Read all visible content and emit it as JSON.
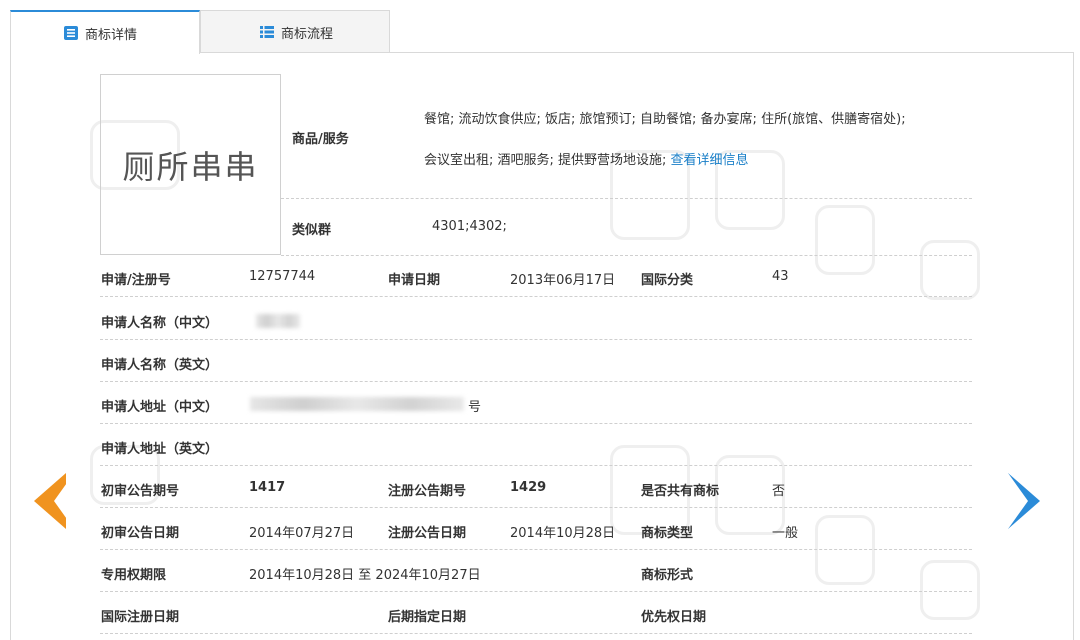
{
  "tabs": [
    {
      "label": "商标详情",
      "icon": "list-icon",
      "active": true
    },
    {
      "label": "商标流程",
      "icon": "grid-list-icon",
      "active": false
    }
  ],
  "trademark_image_text": "厕所串串",
  "goods_services": {
    "label": "商品/服务",
    "line1": "餐馆; 流动饮食供应; 饭店; 旅馆预订; 自助餐馆; 备办宴席; 住所(旅馆、供膳寄宿处);",
    "line2": "会议室出租; 酒吧服务; 提供野营场地设施;",
    "detail_link": "查看详细信息"
  },
  "similar_group": {
    "label": "类似群",
    "value": "4301;4302;"
  },
  "fields": {
    "reg_no_label": "申请/注册号",
    "reg_no": "12757744",
    "apply_date_label": "申请日期",
    "apply_date": "2013年06月17日",
    "intl_class_label": "国际分类",
    "intl_class": "43",
    "applicant_cn_label": "申请人名称（中文）",
    "applicant_en_label": "申请人名称（英文）",
    "address_cn_label": "申请人地址（中文）",
    "address_cn_suffix": "号",
    "address_en_label": "申请人地址（英文）",
    "prelim_issue_label": "初审公告期号",
    "prelim_issue": "1417",
    "reg_issue_label": "注册公告期号",
    "reg_issue": "1429",
    "shared_label": "是否共有商标",
    "shared": "否",
    "prelim_date_label": "初审公告日期",
    "prelim_date": "2014年07月27日",
    "reg_date_label": "注册公告日期",
    "reg_date": "2014年10月28日",
    "tm_type_label": "商标类型",
    "tm_type": "一般",
    "exclusive_label": "专用权期限",
    "exclusive": "2014年10月28日 至 2024年10月27日",
    "tm_form_label": "商标形式",
    "intl_reg_date_label": "国际注册日期",
    "later_designation_label": "后期指定日期",
    "priority_date_label": "优先权日期"
  },
  "colors": {
    "accent_blue": "#2b8bd8",
    "accent_orange": "#f0931f",
    "link": "#1a7fc8"
  }
}
